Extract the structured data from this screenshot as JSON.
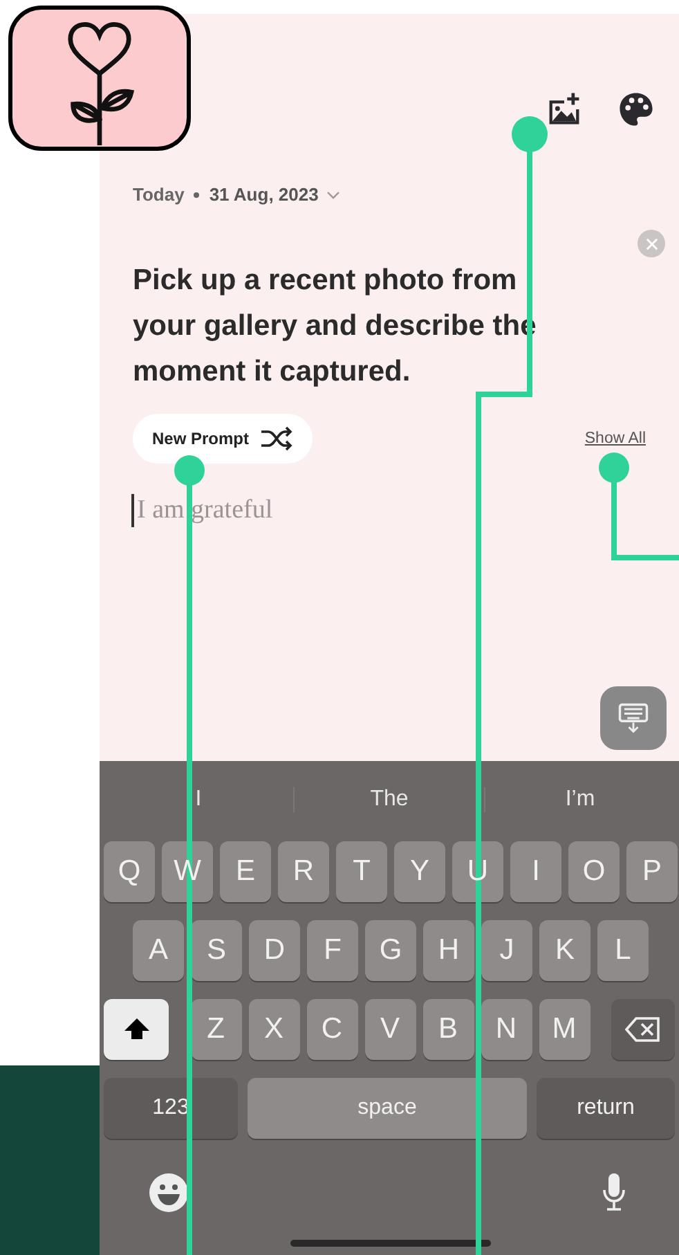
{
  "date": {
    "day": "Today",
    "value": "31 Aug, 2023"
  },
  "prompt": {
    "text": "Pick up a recent photo from your gallery and describe the moment it captured."
  },
  "new_prompt_button": {
    "label": "New Prompt"
  },
  "show_all_link": {
    "label": "Show All"
  },
  "entry_field": {
    "placeholder": "I am grateful"
  },
  "keyboard": {
    "suggestions": [
      "I",
      "The",
      "I’m"
    ],
    "rows": [
      [
        "Q",
        "W",
        "E",
        "R",
        "T",
        "Y",
        "U",
        "I",
        "O",
        "P"
      ],
      [
        "A",
        "S",
        "D",
        "F",
        "G",
        "H",
        "J",
        "K",
        "L"
      ],
      [
        "Z",
        "X",
        "C",
        "V",
        "B",
        "N",
        "M"
      ]
    ],
    "shift_on": true,
    "numbers_key": "123",
    "space_key": "space",
    "return_key": "return"
  }
}
